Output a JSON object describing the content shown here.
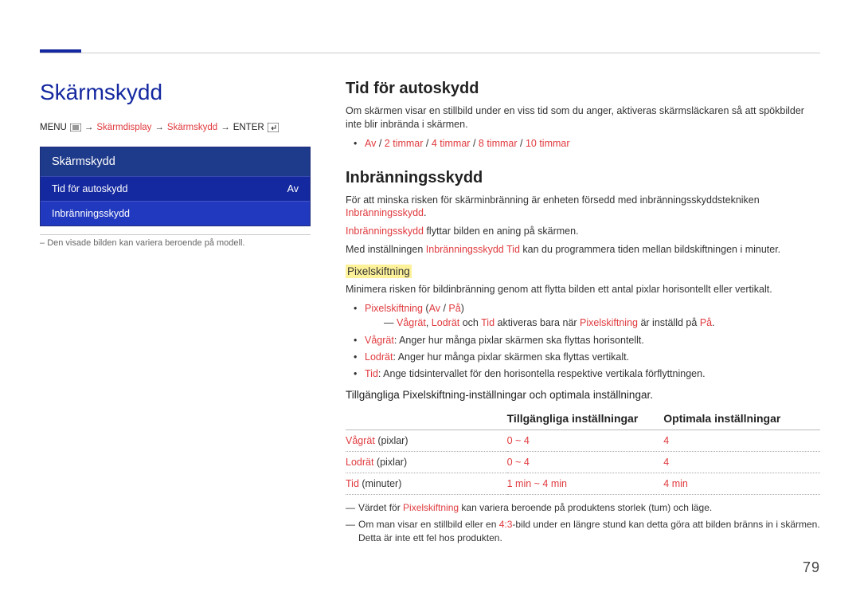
{
  "page_number": "79",
  "doc_title": "Skärmskydd",
  "breadcrumb": {
    "menu": "MENU",
    "display": "Skärmdisplay",
    "screen": "Skärmskydd",
    "enter": "ENTER"
  },
  "panel": {
    "title": "Skärmskydd",
    "row1_label": "Tid för autoskydd",
    "row1_value": "Av",
    "row2_label": "Inbränningsskydd",
    "note_prefix": "–",
    "note": "Den visade bilden kan variera beroende på modell."
  },
  "section1": {
    "heading": "Tid för autoskydd",
    "para": "Om skärmen visar en stillbild under en viss tid som du anger, aktiveras skärmsläckaren så att spökbilder inte blir inbrända i skärmen.",
    "opts_av": "Av",
    "opts_2": "2 timmar",
    "opts_4": "4 timmar",
    "opts_8": "8 timmar",
    "opts_10": "10 timmar"
  },
  "section2": {
    "heading": "Inbränningsskydd",
    "p1a": "För att minska risken för skärminbränning är enheten försedd med inbränningsskyddstekniken ",
    "p1b": "Inbränningsskydd",
    "p1c": ".",
    "p2a": "Inbränningsskydd",
    "p2b": " flyttar bilden en aning på skärmen.",
    "p3a": "Med inställningen ",
    "p3b": "Inbränningsskydd Tid",
    "p3c": " kan du programmera tiden mellan bildskiftningen i minuter."
  },
  "section3": {
    "heading": "Pixelskiftning",
    "para": "Minimera risken för bildinbränning genom att flytta bilden ett antal pixlar horisontellt eller vertikalt.",
    "b1a": "Pixelskiftning",
    "b1b": " (",
    "b1c": "Av",
    "b1d": " / ",
    "b1e": "På",
    "b1f": ")",
    "d1a": "Vågrät",
    "d1b": ", ",
    "d1c": "Lodrät",
    "d1d": " och ",
    "d1e": "Tid",
    "d1f": " aktiveras bara när ",
    "d1g": "Pixelskiftning",
    "d1h": " är inställd på ",
    "d1i": "På",
    "d1j": ".",
    "b2a": "Vågrät",
    "b2b": ": Anger hur många pixlar skärmen ska flyttas horisontellt.",
    "b3a": "Lodrät",
    "b3b": ": Anger hur många pixlar skärmen ska flyttas vertikalt.",
    "b4a": "Tid",
    "b4b": ": Ange tidsintervallet för den horisontella respektive vertikala förflyttningen."
  },
  "table": {
    "intro": "Tillgängliga Pixelskiftning-inställningar och optimala inställningar.",
    "h1": "",
    "h2": "Tillgängliga inställningar",
    "h3": "Optimala inställningar",
    "r1_a": "Vågrät",
    "r1_b": " (pixlar)",
    "r1_c": "0 ~ 4",
    "r1_d": "4",
    "r2_a": "Lodrät",
    "r2_b": " (pixlar)",
    "r2_c": "0 ~ 4",
    "r2_d": "4",
    "r3_a": "Tid",
    "r3_b": " (minuter)",
    "r3_c": "1 min ~ 4 min",
    "r3_d": "4 min"
  },
  "footnotes": {
    "f1a": "Värdet för ",
    "f1b": "Pixelskiftning",
    "f1c": " kan variera beroende på produktens storlek (tum) och läge.",
    "f2a": "Om man visar en stillbild eller en ",
    "f2b": "4:3",
    "f2c": "-bild under en längre stund kan detta göra att bilden bränns in i skärmen. Detta är inte ett fel hos produkten."
  }
}
